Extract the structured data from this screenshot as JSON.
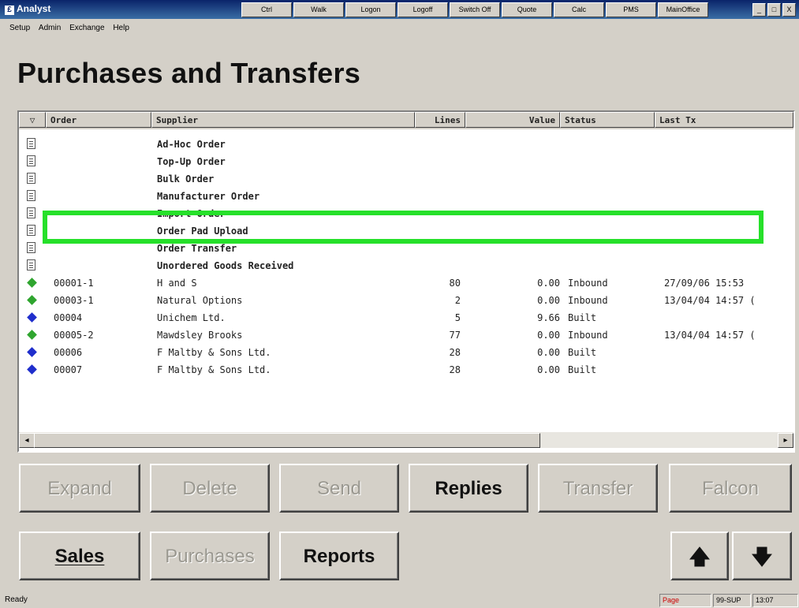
{
  "window": {
    "app_title": "Analyst",
    "toolbar_buttons": [
      "Ctrl",
      "Walk",
      "Logon",
      "Logoff",
      "Switch Off",
      "Quote",
      "Calc",
      "PMS",
      "MainOffice"
    ],
    "controls": {
      "minimize": "_",
      "restore": "□",
      "close": "X"
    }
  },
  "menu": [
    "Setup",
    "Admin",
    "Exchange",
    "Help"
  ],
  "page_title": "Purchases and Transfers",
  "table": {
    "headers": {
      "filter": "▽",
      "order": "Order",
      "supplier": "Supplier",
      "lines": "Lines",
      "value": "Value",
      "status": "Status",
      "last_tx": "Last Tx"
    },
    "template_rows": [
      {
        "supplier": "Ad-Hoc Order"
      },
      {
        "supplier": "Top-Up Order"
      },
      {
        "supplier": "Bulk Order"
      },
      {
        "supplier": "Manufacturer Order"
      },
      {
        "supplier": "Import Order"
      },
      {
        "supplier": "Order Pad Upload"
      },
      {
        "supplier": "Order Transfer"
      },
      {
        "supplier": "Unordered Goods Received"
      }
    ],
    "order_rows": [
      {
        "icon": "green",
        "order": "00001-1",
        "supplier": "H and S",
        "lines": "80",
        "value": "0.00",
        "status": "Inbound",
        "last_tx": "27/09/06 15:53"
      },
      {
        "icon": "green",
        "order": "00003-1",
        "supplier": "Natural Options",
        "lines": "2",
        "value": "0.00",
        "status": "Inbound",
        "last_tx": "13/04/04 14:57 ("
      },
      {
        "icon": "blue",
        "order": "00004",
        "supplier": "Unichem Ltd.",
        "lines": "5",
        "value": "9.66",
        "status": "Built",
        "last_tx": ""
      },
      {
        "icon": "green",
        "order": "00005-2",
        "supplier": "Mawdsley Brooks",
        "lines": "77",
        "value": "0.00",
        "status": "Inbound",
        "last_tx": "13/04/04 14:57 ("
      },
      {
        "icon": "blue",
        "order": "00006",
        "supplier": "F Maltby & Sons Ltd.",
        "lines": "28",
        "value": "0.00",
        "status": "Built",
        "last_tx": ""
      },
      {
        "icon": "blue",
        "order": "00007",
        "supplier": "F Maltby & Sons Ltd.",
        "lines": "28",
        "value": "0.00",
        "status": "Built",
        "last_tx": ""
      }
    ],
    "scroll_left": "◂",
    "scroll_right": "▸"
  },
  "buttons_row1": [
    {
      "label": "Expand",
      "enabled": false
    },
    {
      "label": "Delete",
      "enabled": false
    },
    {
      "label": "Send",
      "enabled": false
    },
    {
      "label": "Replies",
      "enabled": true
    },
    {
      "label": "Transfer",
      "enabled": false
    },
    {
      "label": "Falcon",
      "enabled": false
    }
  ],
  "buttons_row2": [
    {
      "label": "Sales",
      "enabled": true
    },
    {
      "label": "Purchases",
      "enabled": false
    },
    {
      "label": "Reports",
      "enabled": true
    }
  ],
  "nav_buttons": {
    "up": "🡅",
    "down": "🡇"
  },
  "status": {
    "ready": "Ready",
    "page": "Page",
    "date": "99-SUP",
    "time": "13:07"
  },
  "colors": {
    "highlight_box": "#26e02a",
    "green_icon": "#2fa52f",
    "blue_icon": "#1f2ecc",
    "status_page": "#cc0000"
  }
}
